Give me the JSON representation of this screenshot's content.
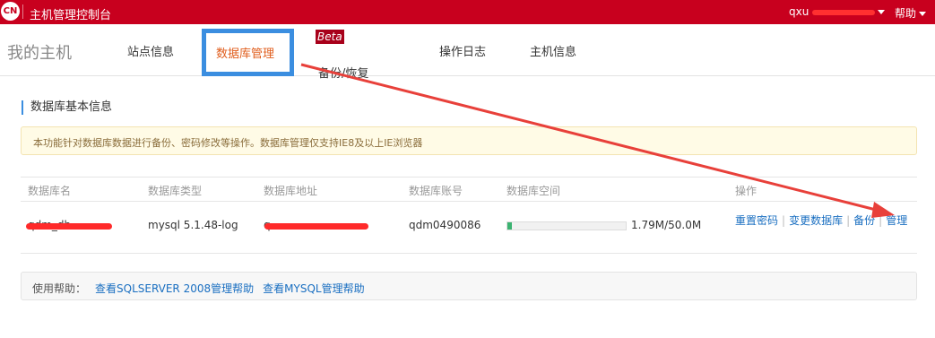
{
  "topbar": {
    "logo_text": "CN",
    "title": "主机管理控制台",
    "user_label": "qxu",
    "help_label": "帮助"
  },
  "nav": {
    "brand": "我的主机",
    "items": [
      {
        "label": "站点信息"
      },
      {
        "label": "数据库管理",
        "active": true
      },
      {
        "label": "备份/恢复",
        "badge": "Beta"
      },
      {
        "label": "操作日志"
      },
      {
        "label": "主机信息"
      }
    ]
  },
  "section": {
    "title": "数据库基本信息",
    "notice": "本功能针对数据库数据进行备份、密码修改等操作。数据库管理仅支持IE8及以上IE浏览器"
  },
  "table": {
    "headers": [
      "数据库名",
      "数据库类型",
      "数据库地址",
      "数据库账号",
      "数据库空间",
      "操作"
    ],
    "row": {
      "name": "qdm_db",
      "type": "mysql 5.1.48-log",
      "address": "q",
      "account": "qdm0490086",
      "space_used_fraction": 0.036,
      "space_text": "1.79M/50.0M",
      "ops": [
        "重置密码",
        "变更数据库",
        "备份",
        "管理"
      ]
    }
  },
  "help": {
    "label": "使用帮助：",
    "links": [
      "查看SQLSERVER 2008管理帮助",
      "查看MYSQL管理帮助"
    ]
  },
  "colors": {
    "topbar": "#c8001e",
    "accent_blue": "#3b8ee0",
    "active_tab": "#e05d1c",
    "link": "#1a6fc1",
    "annotation_arrow": "#e8403a"
  }
}
